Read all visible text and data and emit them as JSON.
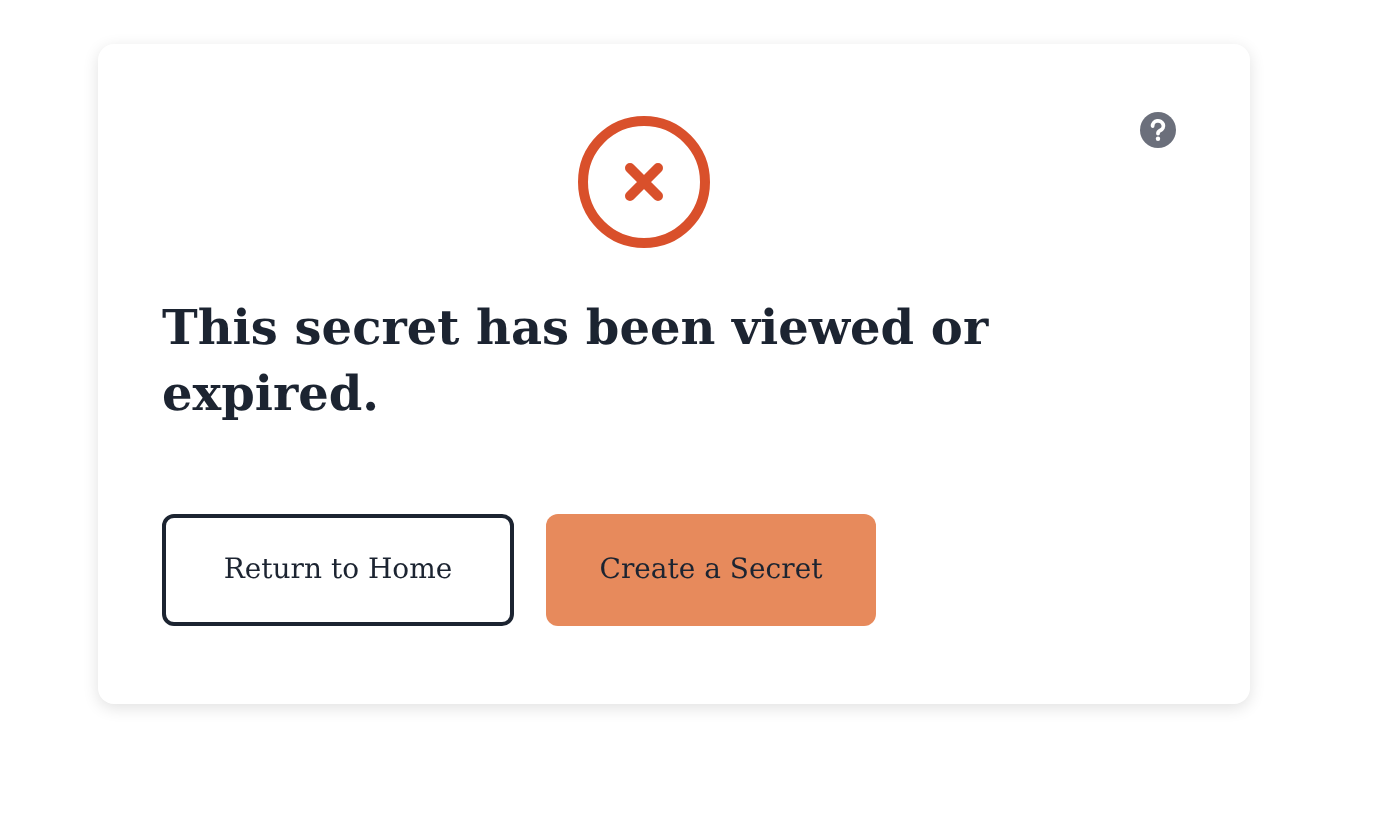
{
  "message": {
    "title": "This secret has been viewed or expired."
  },
  "buttons": [
    {
      "label": "Return to Home",
      "kind": "outline"
    },
    {
      "label": "Create a Secret",
      "kind": "filled"
    }
  ]
}
